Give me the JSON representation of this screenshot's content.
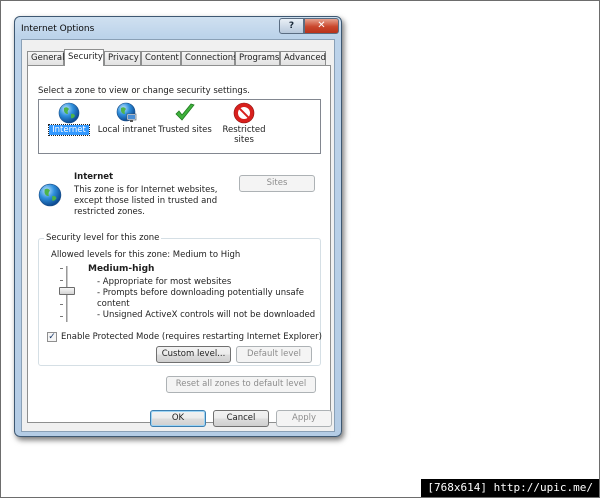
{
  "window": {
    "title": "Internet Options",
    "help": "?",
    "close": "✕"
  },
  "tabs": [
    "General",
    "Security",
    "Privacy",
    "Content",
    "Connections",
    "Programs",
    "Advanced"
  ],
  "security": {
    "prompt": "Select a zone to view or change security settings.",
    "zones": [
      {
        "label": "Internet",
        "icon": "globe-icon"
      },
      {
        "label": "Local intranet",
        "icon": "intranet-globe-icon"
      },
      {
        "label": "Trusted sites",
        "icon": "checkmark-icon"
      },
      {
        "label_line1": "Restricted",
        "label_line2": "sites",
        "icon": "no-entry-icon"
      }
    ],
    "selected_zone": {
      "name": "Internet",
      "desc_line1": "This zone is for Internet websites,",
      "desc_line2": "except those listed in trusted and",
      "desc_line3": "restricted zones."
    },
    "sites_button": "Sites",
    "level_group_title": "Security level for this zone",
    "allowed_levels": "Allowed levels for this zone: Medium to High",
    "level_name": "Medium-high",
    "level_points": [
      "- Appropriate for most websites",
      "- Prompts before downloading potentially unsafe",
      "content",
      "- Unsigned ActiveX controls will not be downloaded"
    ],
    "protected_mode": {
      "label": "Enable Protected Mode (requires restarting Internet Explorer)",
      "checked": true,
      "mark": "✓"
    },
    "custom_level": "Custom level...",
    "default_level": "Default level",
    "reset_all": "Reset all zones to default level"
  },
  "buttons": {
    "ok": "OK",
    "cancel": "Cancel",
    "apply": "Apply"
  },
  "footer": "[768x614] http://upic.me/",
  "colors": {
    "selection": "#3399ff",
    "close_button": "#c9462c",
    "frame": "#b4cce5"
  }
}
